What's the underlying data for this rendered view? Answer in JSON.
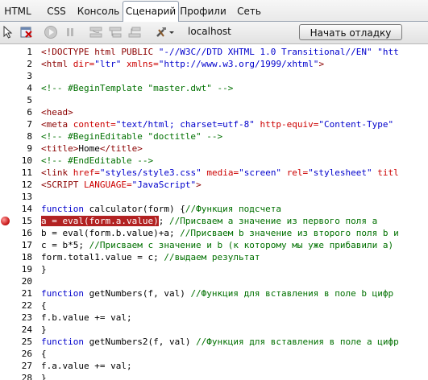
{
  "tabs": [
    "HTML",
    "CSS",
    "Консоль",
    "Сценарий",
    "Профили",
    "Сеть"
  ],
  "active_tab": "Сценарий",
  "toolbar": {
    "icons": [
      "inspect-icon",
      "clear-icon",
      "continue-icon",
      "pause-icon",
      "step-over-icon",
      "step-into-icon",
      "step-out-icon",
      "tools-icon"
    ],
    "location": "localhost",
    "start_label": "Начать отладку"
  },
  "breakpoint_line": 15,
  "lines": [
    {
      "n": "1",
      "tokens": [
        {
          "t": "<!DOCTYPE html PUBLIC ",
          "c": "c-brown"
        },
        {
          "t": "\"-//W3C//DTD XHTML 1.0 Transitional//EN\"",
          "c": "c-blue"
        },
        {
          "t": " \"htt",
          "c": "c-blue"
        }
      ]
    },
    {
      "n": "2",
      "tokens": [
        {
          "t": "<html ",
          "c": "c-brown"
        },
        {
          "t": "dir=",
          "c": "c-red"
        },
        {
          "t": "\"ltr\" ",
          "c": "c-blue"
        },
        {
          "t": "xmlns=",
          "c": "c-red"
        },
        {
          "t": "\"http://www.w3.org/1999/xhtml\"",
          "c": "c-blue"
        },
        {
          "t": ">",
          "c": "c-brown"
        }
      ]
    },
    {
      "n": "3",
      "tokens": []
    },
    {
      "n": "4",
      "tokens": [
        {
          "t": "<!-- #BeginTemplate \"master.dwt\" -->",
          "c": "c-green"
        }
      ]
    },
    {
      "n": "5",
      "tokens": []
    },
    {
      "n": "6",
      "tokens": [
        {
          "t": "<head>",
          "c": "c-brown"
        }
      ]
    },
    {
      "n": "7",
      "tokens": [
        {
          "t": "<meta ",
          "c": "c-brown"
        },
        {
          "t": "content=",
          "c": "c-red"
        },
        {
          "t": "\"text/html; charset=utf-8\" ",
          "c": "c-blue"
        },
        {
          "t": "http-equiv=",
          "c": "c-red"
        },
        {
          "t": "\"Content-Type\"",
          "c": "c-blue"
        }
      ]
    },
    {
      "n": "8",
      "tokens": [
        {
          "t": "<!-- #BeginEditable \"doctitle\" -->",
          "c": "c-green"
        }
      ]
    },
    {
      "n": "9",
      "tokens": [
        {
          "t": "<title>",
          "c": "c-brown"
        },
        {
          "t": "Home",
          "c": ""
        },
        {
          "t": "</title>",
          "c": "c-brown"
        }
      ]
    },
    {
      "n": "10",
      "tokens": [
        {
          "t": "<!-- #EndEditable -->",
          "c": "c-green"
        }
      ]
    },
    {
      "n": "11",
      "tokens": [
        {
          "t": "<link ",
          "c": "c-brown"
        },
        {
          "t": "href=",
          "c": "c-red"
        },
        {
          "t": "\"styles/style3.css\" ",
          "c": "c-blue"
        },
        {
          "t": "media=",
          "c": "c-red"
        },
        {
          "t": "\"screen\" ",
          "c": "c-blue"
        },
        {
          "t": "rel=",
          "c": "c-red"
        },
        {
          "t": "\"stylesheet\" ",
          "c": "c-blue"
        },
        {
          "t": "titl",
          "c": "c-red"
        }
      ]
    },
    {
      "n": "12",
      "tokens": [
        {
          "t": "<SCRIPT ",
          "c": "c-brown"
        },
        {
          "t": "LANGUAGE=",
          "c": "c-red"
        },
        {
          "t": "\"JavaScript\"",
          "c": "c-blue"
        },
        {
          "t": ">",
          "c": "c-brown"
        }
      ]
    },
    {
      "n": "13",
      "tokens": []
    },
    {
      "n": "14",
      "tokens": [
        {
          "t": "function",
          "c": "c-blue"
        },
        {
          "t": " calculator(form) {",
          "c": ""
        },
        {
          "t": "//Функция подсчета",
          "c": "c-green"
        }
      ]
    },
    {
      "n": "15",
      "tokens": [
        {
          "t": "a = eval(form.a.value)",
          "c": "hl"
        },
        {
          "t": "; ",
          "c": ""
        },
        {
          "t": "//Присваем а значение из первого поля a",
          "c": "c-green"
        }
      ]
    },
    {
      "n": "16",
      "tokens": [
        {
          "t": "b = eval(form.b.value)+a; ",
          "c": ""
        },
        {
          "t": "//Присваем b значение из второго поля b и",
          "c": "c-green"
        }
      ]
    },
    {
      "n": "17",
      "tokens": [
        {
          "t": "c = b*5; ",
          "c": ""
        },
        {
          "t": "//Присваем с значение и b (к которому мы уже прибавили a)",
          "c": "c-green"
        }
      ]
    },
    {
      "n": "18",
      "tokens": [
        {
          "t": "form.total1.value = c; ",
          "c": ""
        },
        {
          "t": "//выдаем результат",
          "c": "c-green"
        }
      ]
    },
    {
      "n": "19",
      "tokens": [
        {
          "t": "}",
          "c": ""
        }
      ]
    },
    {
      "n": "20",
      "tokens": []
    },
    {
      "n": "21",
      "tokens": [
        {
          "t": "function",
          "c": "c-blue"
        },
        {
          "t": " getNumbers(f, val) ",
          "c": ""
        },
        {
          "t": "//Функция для вставления в поле b цифр",
          "c": "c-green"
        }
      ]
    },
    {
      "n": "22",
      "tokens": [
        {
          "t": "{",
          "c": ""
        }
      ]
    },
    {
      "n": "23",
      "tokens": [
        {
          "t": "f.b.value += val;",
          "c": ""
        }
      ]
    },
    {
      "n": "24",
      "tokens": [
        {
          "t": "}",
          "c": ""
        }
      ]
    },
    {
      "n": "25",
      "tokens": [
        {
          "t": "function",
          "c": "c-blue"
        },
        {
          "t": " getNumbers2(f, val) ",
          "c": ""
        },
        {
          "t": "//Функция для вставления в поле a цифр",
          "c": "c-green"
        }
      ]
    },
    {
      "n": "26",
      "tokens": [
        {
          "t": "{",
          "c": ""
        }
      ]
    },
    {
      "n": "27",
      "tokens": [
        {
          "t": "f.a.value += val;",
          "c": ""
        }
      ]
    },
    {
      "n": "28",
      "tokens": [
        {
          "t": "}",
          "c": ""
        }
      ]
    }
  ]
}
